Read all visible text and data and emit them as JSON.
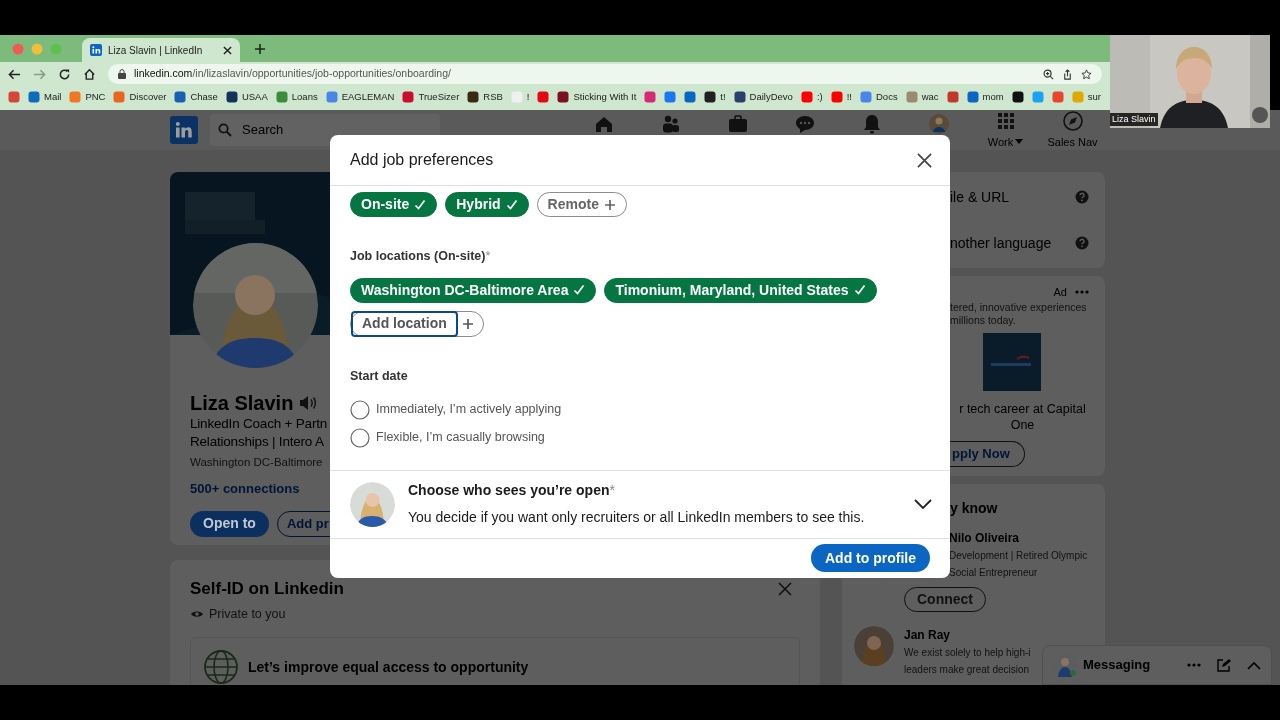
{
  "browser": {
    "tab_title": "Liza Slavin | LinkedIn",
    "url_host": "linkedin.com",
    "url_path": "/in/lizaslavin/opportunities/job-opportunities/onboarding/",
    "bookmarks": [
      {
        "color": "#d44638"
      },
      {
        "label": "Mail",
        "color": "#0f6cbd"
      },
      {
        "label": "PNC",
        "color": "#ef7622"
      },
      {
        "label": "Discover",
        "color": "#e8671f"
      },
      {
        "label": "Chase",
        "color": "#1a5fb4"
      },
      {
        "label": "USAA",
        "color": "#12325c"
      },
      {
        "label": "Loans",
        "color": "#3c8c3c"
      },
      {
        "label": "EAGLEMAN",
        "color": "#4a86e8"
      },
      {
        "label": "TrueSizer",
        "color": "#c8102e"
      },
      {
        "label": "RSB",
        "color": "#3a2a10"
      },
      {
        "label": "!",
        "color": "#f0f0f0"
      },
      {
        "color": "#e50914"
      },
      {
        "label": "Sticking With It",
        "color": "#7a1020"
      },
      {
        "color": "#d62976"
      },
      {
        "color": "#1877f2"
      },
      {
        "color": "#0a66c2"
      },
      {
        "label": "t!",
        "color": "#202020"
      },
      {
        "label": "DailyDevo",
        "color": "#2a3f6b"
      },
      {
        "label": ":)",
        "color": "#ff0000"
      },
      {
        "label": "!!",
        "color": "#ff0000"
      },
      {
        "label": "Docs",
        "color": "#4a86e8"
      },
      {
        "label": "wac",
        "color": "#9a8a70"
      },
      {
        "color": "#c0392b"
      },
      {
        "label": "mom",
        "color": "#0a66c2"
      },
      {
        "color": "#111111"
      },
      {
        "color": "#1da1f2"
      },
      {
        "color": "#e8452c"
      },
      {
        "label": "sur",
        "color": "#e0a800"
      }
    ]
  },
  "video_call": {
    "name": "Liza Slavin"
  },
  "nav": {
    "search_placeholder": "Search",
    "items": [
      {
        "kind": "home"
      },
      {
        "kind": "network"
      },
      {
        "kind": "jobs"
      },
      {
        "kind": "messaging"
      },
      {
        "kind": "notifications"
      },
      {
        "kind": "me"
      },
      {
        "kind": "work",
        "label": "Work"
      },
      {
        "kind": "sales",
        "label": "Sales Nav"
      }
    ]
  },
  "profile": {
    "name": "Liza Slavin",
    "headline_lines": [
      "LinkedIn Coach + Partn",
      "Relationships | Intero A"
    ],
    "location": "Washington DC-Baltimore",
    "connections": "500+ connections",
    "buttons": [
      "Open to",
      "Add pr"
    ]
  },
  "self_id": {
    "title": "Self-ID on Linkedin",
    "privacy": "Private to you",
    "banner_text": "Let’s improve equal access to opportunity"
  },
  "right_rail": {
    "help_items": [
      "ile & URL",
      "nother language"
    ],
    "ad": {
      "label": "Ad",
      "text_lines": [
        "tered, innovative experiences",
        "millions today."
      ],
      "headline": "r tech career at Capital One",
      "button": "pply Now"
    },
    "people": {
      "title": "y know",
      "items": [
        {
          "name": "Nilo Oliveira",
          "lines": [
            "Development | Retired Olympic",
            "Social Entrepreneur"
          ],
          "button": "Connect"
        },
        {
          "name": "Jan Ray",
          "lines": [
            "We exist solely to help high-i",
            "leaders make great decision"
          ]
        }
      ]
    }
  },
  "messaging": {
    "label": "Messaging"
  },
  "modal": {
    "title": "Add job preferences",
    "workplace_types": [
      {
        "label": "On-site",
        "selected": true
      },
      {
        "label": "Hybrid",
        "selected": true
      },
      {
        "label": "Remote",
        "selected": false
      }
    ],
    "locations_label": "Job locations (On-site)",
    "required_mark": "*",
    "locations": [
      {
        "label": "Washington DC-Baltimore Area",
        "selected": true
      },
      {
        "label": "Timonium, Maryland, United States",
        "selected": true
      }
    ],
    "add_location": "Add location",
    "start_date_label": "Start date",
    "start_date_options": [
      {
        "label": "Immediately, I’m actively applying",
        "selected": false
      },
      {
        "label": "Flexible, I’m casually browsing",
        "selected": false
      }
    ],
    "visibility": {
      "title": "Choose who sees you’re open",
      "required_mark": "*",
      "description": "You decide if you want only recruiters or all LinkedIn members to see this.",
      "expanded": false
    },
    "submit": "Add to profile"
  }
}
